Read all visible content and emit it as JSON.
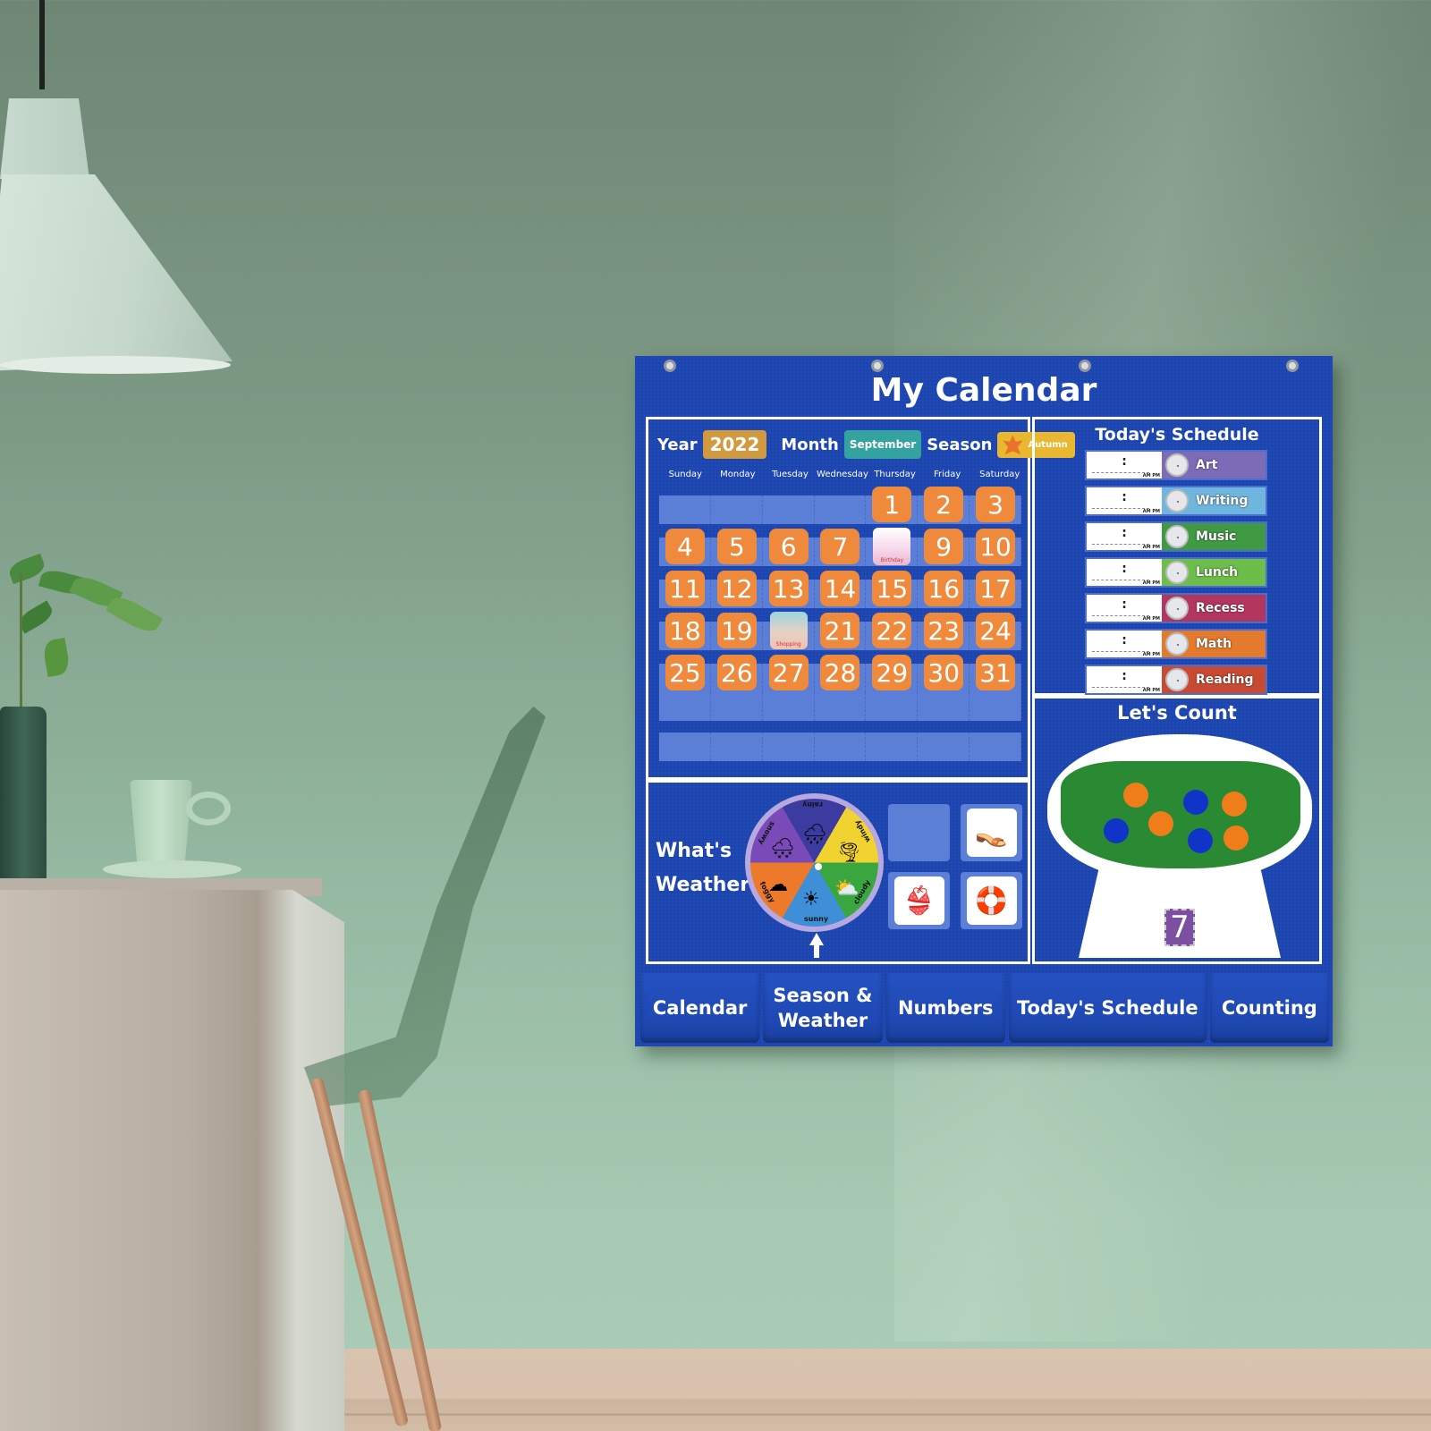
{
  "scene": {
    "description": "Dining corner with sage-green wall, pendant lamp, vase with plant, cup and saucer on a beige table, translucent green chair, and a blue classroom calendar pocket chart hanging on the wall",
    "colors": {
      "wall": "#7d9a85",
      "chart_blue": "#1c45b0",
      "day_orange": "#ef8a3c",
      "pocket_slot": "#5b7fd6",
      "felt_green": "#2a8a33"
    }
  },
  "chart": {
    "title": "My Calendar",
    "calendar": {
      "year_label": "Year",
      "year_value": "2022",
      "month_label": "Month",
      "month_value": "September",
      "season_label": "Season",
      "season_value": "Autumn",
      "weekdays": [
        "Sunday",
        "Monday",
        "Tuesday",
        "Wednesday",
        "Thursday",
        "Friday",
        "Saturday"
      ],
      "weeks": [
        [
          "",
          "",
          "",
          "",
          "1",
          "2",
          "3"
        ],
        [
          "4",
          "5",
          "6",
          "7",
          "pic:Birthday",
          "9",
          "10"
        ],
        [
          "11",
          "12",
          "13",
          "14",
          "15",
          "16",
          "17"
        ],
        [
          "18",
          "19",
          "pic:Shopping",
          "21",
          "22",
          "23",
          "24"
        ],
        [
          "25",
          "26",
          "27",
          "28",
          "29",
          "30",
          "31"
        ]
      ],
      "empty_row_count": 2
    },
    "schedule": {
      "title": "Today's Schedule",
      "time_placeholder": ":",
      "ampm": "AM PM",
      "items": [
        {
          "label": "Art",
          "color": "#7d6bb8"
        },
        {
          "label": "Writing",
          "color": "#6fb6df"
        },
        {
          "label": "Music",
          "color": "#3f9a43"
        },
        {
          "label": "Lunch",
          "color": "#6cbd4a"
        },
        {
          "label": "Recess",
          "color": "#b2365e"
        },
        {
          "label": "Math",
          "color": "#e37a2d"
        },
        {
          "label": "Reading",
          "color": "#c94a32"
        }
      ]
    },
    "weather": {
      "title_line1": "What's",
      "title_line2": "Weather?",
      "wheel_segments": [
        "rainy",
        "windy",
        "cloudy",
        "sunny",
        "foggy",
        "snowy"
      ],
      "selected": "sunny",
      "clothing_cards": [
        "flip-flops",
        "swimsuit",
        "life-ring"
      ]
    },
    "counting": {
      "title": "Let's Count",
      "beads": [
        {
          "color": "#ef7d1a"
        },
        {
          "color": "#1034c8"
        },
        {
          "color": "#ef7d1a"
        },
        {
          "color": "#1034c8"
        },
        {
          "color": "#ef7d1a"
        },
        {
          "color": "#1034c8"
        },
        {
          "color": "#ef7d1a"
        }
      ],
      "number_card": "7"
    },
    "pockets": [
      "Calendar",
      "Season & Weather",
      "Numbers",
      "Today's Schedule",
      "Counting"
    ]
  }
}
